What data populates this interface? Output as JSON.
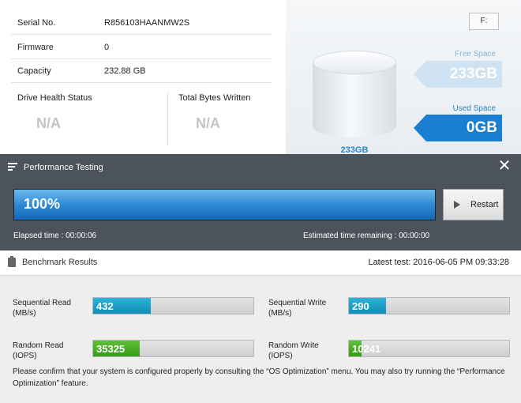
{
  "drive_info": {
    "serial_label": "Serial No.",
    "serial_value": "R856103HAANMW2S",
    "firmware_label": "Firmware",
    "firmware_value": "0",
    "capacity_label": "Capacity",
    "capacity_value": "232.88 GB",
    "health_label": "Drive Health Status",
    "health_value": "N/A",
    "tbw_label": "Total Bytes Written",
    "tbw_value": "N/A"
  },
  "space": {
    "drive_letter": "F:",
    "free_label": "Free Space",
    "free_value": "233GB",
    "used_label": "Used Space",
    "used_value": "0GB",
    "cylinder_label": "233GB"
  },
  "performance": {
    "title": "Performance Testing",
    "progress_text": "100%",
    "progress_fraction": 1.0,
    "restart_label": "Restart",
    "elapsed": "Elapsed time : 00:00:06",
    "remaining": "Estimated time remaining : 00:00:00"
  },
  "benchmark": {
    "title": "Benchmark Results",
    "latest_test": "Latest test: 2016-06-05 PM 09:33:28",
    "metrics": [
      {
        "label_line1": "Sequential Read",
        "label_line2": "(MB/s)",
        "value": "432",
        "fraction": 0.36,
        "color": "#1aa0c8"
      },
      {
        "label_line1": "Sequential Write",
        "label_line2": "(MB/s)",
        "value": "290",
        "fraction": 0.23,
        "color": "#1aa0c8"
      },
      {
        "label_line1": "Random Read",
        "label_line2": "(IOPS)",
        "value": "35325",
        "fraction": 0.29,
        "color": "#46ad28"
      },
      {
        "label_line1": "Random Write",
        "label_line2": "(IOPS)",
        "value": "10241",
        "fraction": 0.08,
        "color": "#46ad28"
      }
    ],
    "note": "Please confirm that your system is configured properly by consulting the “OS Optimization” menu. You may also try running the “Performance Optimization” feature."
  }
}
